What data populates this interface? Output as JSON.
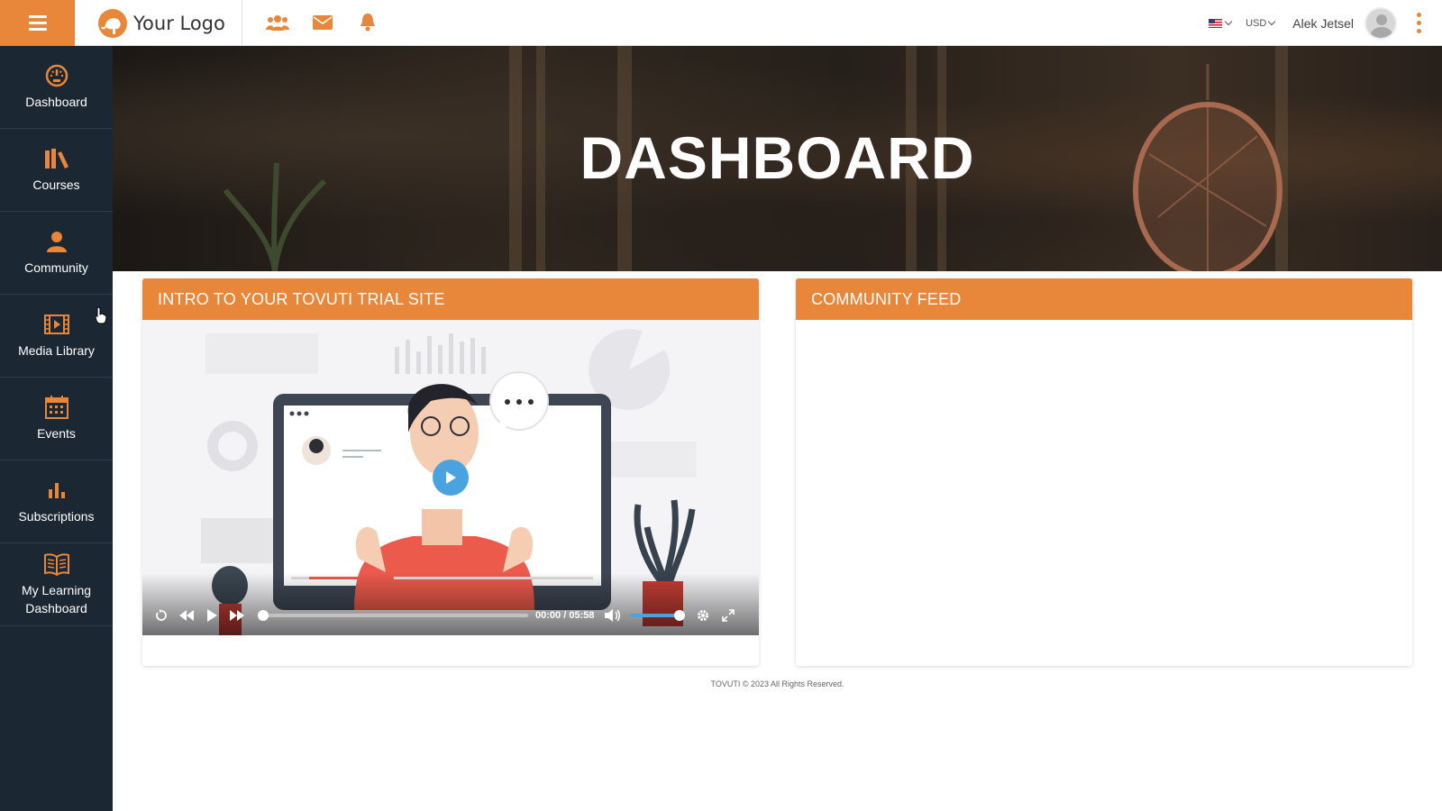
{
  "header": {
    "logo_text": "Your Logo",
    "currency": "USD",
    "user_name": "Alek Jetsel"
  },
  "colors": {
    "accent": "#e8863a",
    "sidebar": "#1c2734",
    "progress_blue": "#4aa3df"
  },
  "sidebar": {
    "items": [
      {
        "label": "Dashboard",
        "icon": "dashboard-gauge-icon"
      },
      {
        "label": "Courses",
        "icon": "books-icon"
      },
      {
        "label": "Community",
        "icon": "community-user-icon"
      },
      {
        "label": "Media Library",
        "icon": "film-icon"
      },
      {
        "label": "Events",
        "icon": "calendar-icon"
      },
      {
        "label": "Subscriptions",
        "icon": "bar-chart-icon"
      },
      {
        "label": "My Learning Dashboard",
        "icon": "open-book-icon"
      }
    ]
  },
  "hero": {
    "title": "DASHBOARD"
  },
  "intro_card": {
    "title": "INTRO TO YOUR TOVUTI TRIAL SITE",
    "video": {
      "current_time": "00:00",
      "separator": "/",
      "duration": "05:58",
      "progress": 0,
      "volume": 1.0
    }
  },
  "community_card": {
    "title": "COMMUNITY FEED"
  },
  "footer": {
    "text": "TOVUTI © 2023 All Rights Reserved."
  }
}
